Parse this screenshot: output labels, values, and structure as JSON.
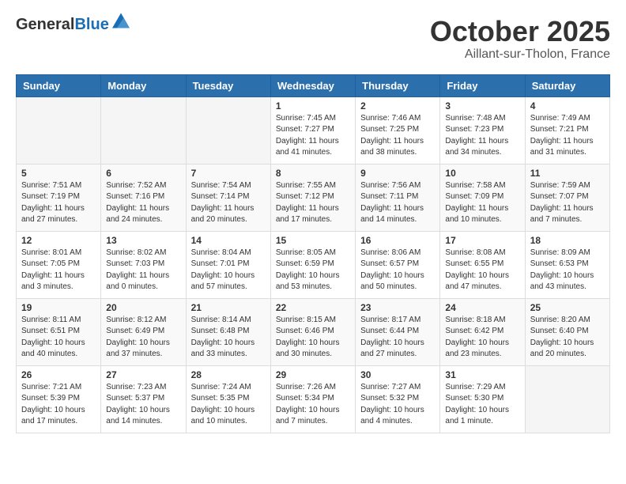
{
  "header": {
    "logo": {
      "general": "General",
      "blue": "Blue"
    },
    "title": "October 2025",
    "location": "Aillant-sur-Tholon, France"
  },
  "days_of_week": [
    "Sunday",
    "Monday",
    "Tuesday",
    "Wednesday",
    "Thursday",
    "Friday",
    "Saturday"
  ],
  "weeks": [
    [
      {
        "day": "",
        "info": ""
      },
      {
        "day": "",
        "info": ""
      },
      {
        "day": "",
        "info": ""
      },
      {
        "day": "1",
        "info": "Sunrise: 7:45 AM\nSunset: 7:27 PM\nDaylight: 11 hours\nand 41 minutes."
      },
      {
        "day": "2",
        "info": "Sunrise: 7:46 AM\nSunset: 7:25 PM\nDaylight: 11 hours\nand 38 minutes."
      },
      {
        "day": "3",
        "info": "Sunrise: 7:48 AM\nSunset: 7:23 PM\nDaylight: 11 hours\nand 34 minutes."
      },
      {
        "day": "4",
        "info": "Sunrise: 7:49 AM\nSunset: 7:21 PM\nDaylight: 11 hours\nand 31 minutes."
      }
    ],
    [
      {
        "day": "5",
        "info": "Sunrise: 7:51 AM\nSunset: 7:19 PM\nDaylight: 11 hours\nand 27 minutes."
      },
      {
        "day": "6",
        "info": "Sunrise: 7:52 AM\nSunset: 7:16 PM\nDaylight: 11 hours\nand 24 minutes."
      },
      {
        "day": "7",
        "info": "Sunrise: 7:54 AM\nSunset: 7:14 PM\nDaylight: 11 hours\nand 20 minutes."
      },
      {
        "day": "8",
        "info": "Sunrise: 7:55 AM\nSunset: 7:12 PM\nDaylight: 11 hours\nand 17 minutes."
      },
      {
        "day": "9",
        "info": "Sunrise: 7:56 AM\nSunset: 7:11 PM\nDaylight: 11 hours\nand 14 minutes."
      },
      {
        "day": "10",
        "info": "Sunrise: 7:58 AM\nSunset: 7:09 PM\nDaylight: 11 hours\nand 10 minutes."
      },
      {
        "day": "11",
        "info": "Sunrise: 7:59 AM\nSunset: 7:07 PM\nDaylight: 11 hours\nand 7 minutes."
      }
    ],
    [
      {
        "day": "12",
        "info": "Sunrise: 8:01 AM\nSunset: 7:05 PM\nDaylight: 11 hours\nand 3 minutes."
      },
      {
        "day": "13",
        "info": "Sunrise: 8:02 AM\nSunset: 7:03 PM\nDaylight: 11 hours\nand 0 minutes."
      },
      {
        "day": "14",
        "info": "Sunrise: 8:04 AM\nSunset: 7:01 PM\nDaylight: 10 hours\nand 57 minutes."
      },
      {
        "day": "15",
        "info": "Sunrise: 8:05 AM\nSunset: 6:59 PM\nDaylight: 10 hours\nand 53 minutes."
      },
      {
        "day": "16",
        "info": "Sunrise: 8:06 AM\nSunset: 6:57 PM\nDaylight: 10 hours\nand 50 minutes."
      },
      {
        "day": "17",
        "info": "Sunrise: 8:08 AM\nSunset: 6:55 PM\nDaylight: 10 hours\nand 47 minutes."
      },
      {
        "day": "18",
        "info": "Sunrise: 8:09 AM\nSunset: 6:53 PM\nDaylight: 10 hours\nand 43 minutes."
      }
    ],
    [
      {
        "day": "19",
        "info": "Sunrise: 8:11 AM\nSunset: 6:51 PM\nDaylight: 10 hours\nand 40 minutes."
      },
      {
        "day": "20",
        "info": "Sunrise: 8:12 AM\nSunset: 6:49 PM\nDaylight: 10 hours\nand 37 minutes."
      },
      {
        "day": "21",
        "info": "Sunrise: 8:14 AM\nSunset: 6:48 PM\nDaylight: 10 hours\nand 33 minutes."
      },
      {
        "day": "22",
        "info": "Sunrise: 8:15 AM\nSunset: 6:46 PM\nDaylight: 10 hours\nand 30 minutes."
      },
      {
        "day": "23",
        "info": "Sunrise: 8:17 AM\nSunset: 6:44 PM\nDaylight: 10 hours\nand 27 minutes."
      },
      {
        "day": "24",
        "info": "Sunrise: 8:18 AM\nSunset: 6:42 PM\nDaylight: 10 hours\nand 23 minutes."
      },
      {
        "day": "25",
        "info": "Sunrise: 8:20 AM\nSunset: 6:40 PM\nDaylight: 10 hours\nand 20 minutes."
      }
    ],
    [
      {
        "day": "26",
        "info": "Sunrise: 7:21 AM\nSunset: 5:39 PM\nDaylight: 10 hours\nand 17 minutes."
      },
      {
        "day": "27",
        "info": "Sunrise: 7:23 AM\nSunset: 5:37 PM\nDaylight: 10 hours\nand 14 minutes."
      },
      {
        "day": "28",
        "info": "Sunrise: 7:24 AM\nSunset: 5:35 PM\nDaylight: 10 hours\nand 10 minutes."
      },
      {
        "day": "29",
        "info": "Sunrise: 7:26 AM\nSunset: 5:34 PM\nDaylight: 10 hours\nand 7 minutes."
      },
      {
        "day": "30",
        "info": "Sunrise: 7:27 AM\nSunset: 5:32 PM\nDaylight: 10 hours\nand 4 minutes."
      },
      {
        "day": "31",
        "info": "Sunrise: 7:29 AM\nSunset: 5:30 PM\nDaylight: 10 hours\nand 1 minute."
      },
      {
        "day": "",
        "info": ""
      }
    ]
  ]
}
